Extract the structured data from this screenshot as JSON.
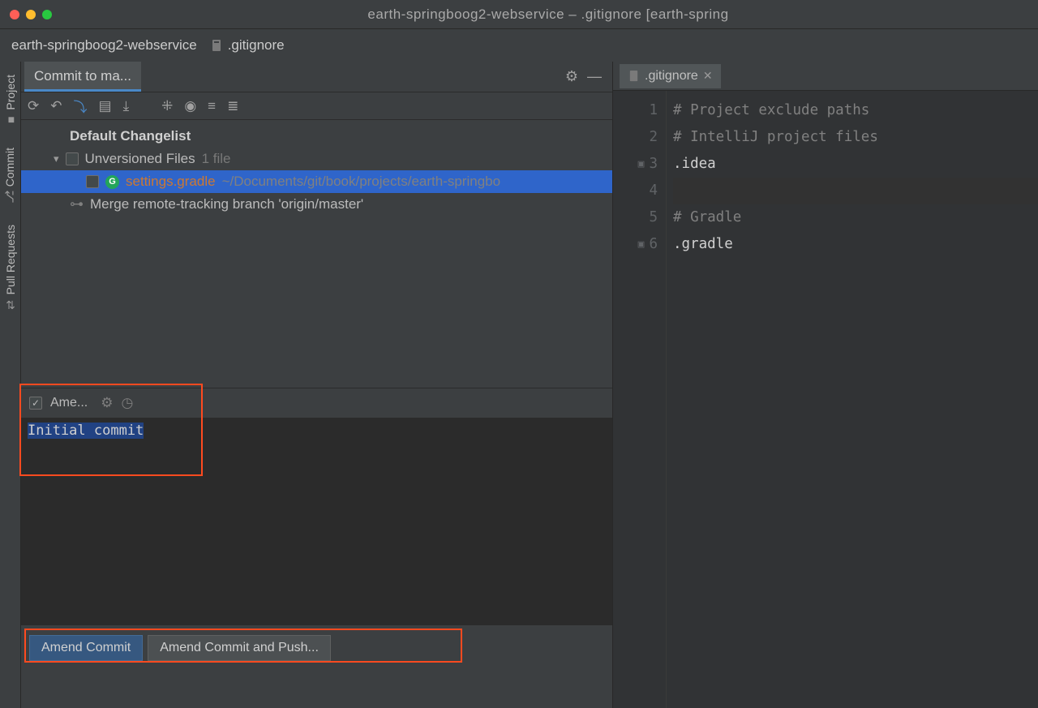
{
  "titlebar": {
    "title": "earth-springboog2-webservice – .gitignore [earth-spring"
  },
  "breadcrumb": {
    "project": "earth-springboog2-webservice",
    "file": ".gitignore"
  },
  "tool_tabs": {
    "project": "Project",
    "commit": "Commit",
    "pull_requests": "Pull Requests"
  },
  "commit_panel": {
    "tab_label": "Commit to ma...",
    "changelist_label": "Default Changelist",
    "unversioned_label": "Unversioned Files",
    "unversioned_count": "1 file",
    "file_name": "settings.gradle",
    "file_path": "~/Documents/git/book/projects/earth-springbo",
    "merge_label": "Merge remote-tracking branch 'origin/master'",
    "amend_label": "Ame...",
    "commit_message": "Initial commit",
    "btn_commit": "Amend Commit",
    "btn_commit_push": "Amend Commit and Push..."
  },
  "editor": {
    "tab_name": ".gitignore",
    "lines": [
      "# Project exclude paths",
      "# IntelliJ project files",
      ".idea",
      "",
      "# Gradle",
      ".gradle"
    ]
  }
}
